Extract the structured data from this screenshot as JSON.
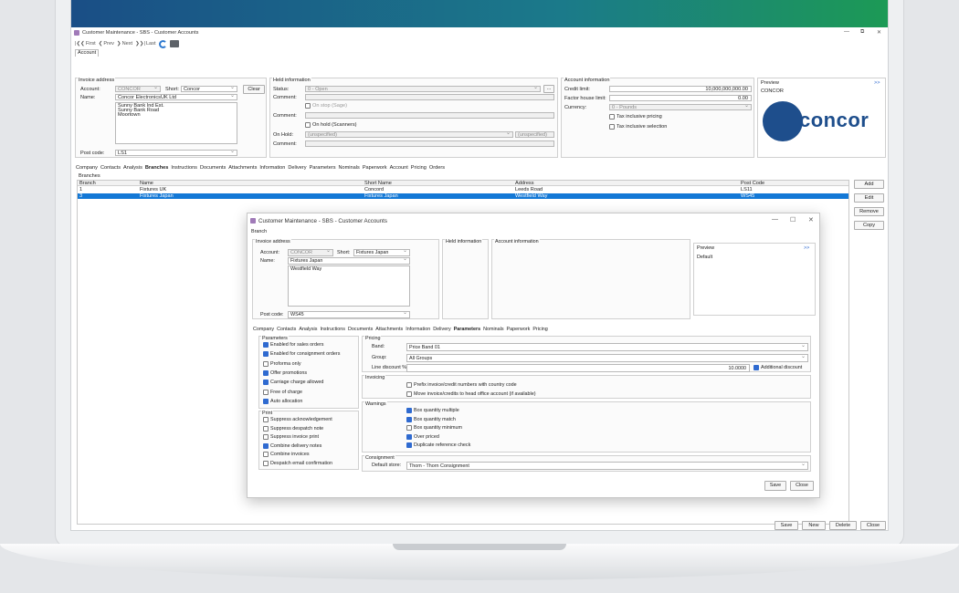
{
  "main": {
    "title": "Customer Maintenance - SBS - Customer Accounts",
    "toolbar": {
      "first": "First",
      "prev": "Prev",
      "next": "Next",
      "last": "Last"
    },
    "tab": "Account",
    "invoice": {
      "title": "Invoice address",
      "account_label": "Account:",
      "account": "CONCOR",
      "short_label": "Short:",
      "short": "Concor",
      "clear": "Clear",
      "name_label": "Name:",
      "name": "Concor ElectronicsUK Ltd",
      "address": [
        "Sunny Bank Ind Est.",
        "Sunny Bank Road",
        "Moortown"
      ],
      "post_label": "Post code:",
      "post": "LS1"
    },
    "held": {
      "title": "Held information",
      "status_label": "Status:",
      "status": "0 - Open",
      "comment_label": "Comment:",
      "onstop": "On stop (Sage)",
      "comment2_label": "Comment:",
      "onhold": "On hold (Scanners)",
      "onhold_label": "On Hold:",
      "onhold_val": "(unspecified)",
      "onhold_val2": "(unspecified)",
      "comment3_label": "Comment:",
      "ellipsis": "..."
    },
    "account": {
      "title": "Account information",
      "credit_label": "Credit limit:",
      "credit": "10,000,000,000.00",
      "factor_label": "Factor house limit:",
      "factor": "0.00",
      "currency_label": "Currency:",
      "currency": "0 - Pounds",
      "taxinc": "Tax inclusive pricing",
      "taxsel": "Tax inclusive selection"
    },
    "preview": {
      "title": "Preview",
      "more": ">>",
      "value": "CONCOR",
      "logo": "concor"
    },
    "tabs": [
      "Company",
      "Contacts",
      "Analysis",
      "Branches",
      "Instructions",
      "Documents",
      "Attachments",
      "Information",
      "Delivery",
      "Parameters",
      "Nominals",
      "Paperwork",
      "Account",
      "Pricing",
      "Orders"
    ],
    "branches": {
      "title": "Branches",
      "columns": [
        "Branch",
        "Name",
        "Short Name",
        "Address",
        "Post Code"
      ],
      "rows": [
        [
          "1",
          "Fixtures UK",
          "Concord",
          "Leeds Road",
          "LS11"
        ],
        [
          "3",
          "Fixtures Japan",
          "Fixtures Japan",
          "Westfield Way",
          "WS45"
        ]
      ]
    },
    "side": {
      "add": "Add",
      "edit": "Edit",
      "remove": "Remove",
      "copy": "Copy"
    },
    "bottom": {
      "save": "Save",
      "new": "New",
      "delete": "Delete",
      "close": "Close"
    }
  },
  "dialog": {
    "title": "Customer Maintenance - SBS - Customer Accounts",
    "tab": "Branch",
    "invoice": {
      "title": "Invoice address",
      "account_label": "Account:",
      "account": "CONCOR",
      "short_label": "Short:",
      "short": "Fixtures Japan",
      "name_label": "Name:",
      "name": "Fixtures Japan",
      "address": [
        "Westfield Way"
      ],
      "post_label": "Post code:",
      "post": "WS45"
    },
    "held_title": "Held information",
    "acct_title": "Account information",
    "preview": {
      "title": "Preview",
      "more": ">>",
      "value": "Default"
    },
    "tabs": [
      "Company",
      "Contacts",
      "Analysis",
      "Instructions",
      "Documents",
      "Attachments",
      "Information",
      "Delivery",
      "Parameters",
      "Nominals",
      "Paperwork",
      "Pricing"
    ],
    "params": {
      "title": "Parameters",
      "items": [
        {
          "label": "Enabled for sales orders",
          "on": true
        },
        {
          "label": "Enabled for consignment orders",
          "on": true
        },
        {
          "label": "Proforma only",
          "on": false
        },
        {
          "label": "Offer promotions",
          "on": true
        },
        {
          "label": "Carriage charge allowed",
          "on": true
        },
        {
          "label": "Free of charge",
          "on": false
        },
        {
          "label": "Auto allocation",
          "on": true
        }
      ]
    },
    "print": {
      "title": "Print",
      "items": [
        {
          "label": "Suppress acknowledgement",
          "on": false
        },
        {
          "label": "Suppress despatch note",
          "on": false
        },
        {
          "label": "Suppress invoice print",
          "on": false
        },
        {
          "label": "Combine delivery notes",
          "on": true
        },
        {
          "label": "Combine invoices",
          "on": false
        },
        {
          "label": "Despatch email confirmation",
          "on": false
        }
      ]
    },
    "pricing": {
      "title": "Pricing",
      "band_label": "Band:",
      "band": "Price Band 01",
      "group_label": "Group:",
      "group": "All Groups",
      "disc_label": "Line discount %:",
      "disc": "10.0000",
      "addl": "Additional discount"
    },
    "invoicing": {
      "title": "Invoicing",
      "prefix": "Prefix invoice/credit numbers with country code",
      "move": "Move invoice/credits to head office account (if available)"
    },
    "warnings": {
      "title": "Warnings",
      "items": [
        {
          "label": "Box quantity multiple",
          "on": true
        },
        {
          "label": "Box quantity match",
          "on": true
        },
        {
          "label": "Box quantity minimum",
          "on": false
        },
        {
          "label": "Over priced",
          "on": true
        },
        {
          "label": "Duplicate reference check",
          "on": true
        }
      ]
    },
    "consignment": {
      "title": "Consignment",
      "store_label": "Default store:",
      "store": "Thom - Thorn Consignment"
    },
    "save": "Save",
    "close": "Close"
  }
}
